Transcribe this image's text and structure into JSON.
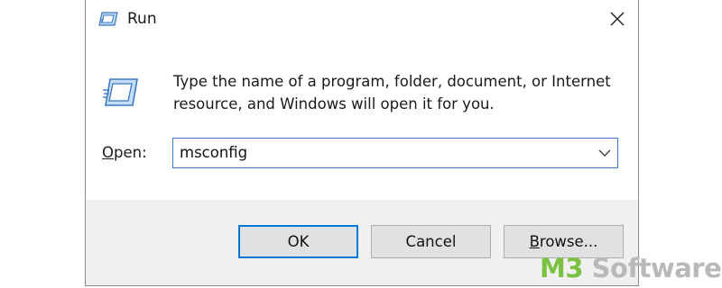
{
  "window": {
    "title": "Run",
    "close_icon": "close-icon",
    "title_icon": "run-app-icon"
  },
  "body": {
    "icon": "run-large-icon",
    "description": "Type the name of a program, folder, document, or Internet resource, and Windows will open it for you.",
    "open_label_accel": "O",
    "open_label_rest": "pen:",
    "input_value": "msconfig",
    "dropdown_icon": "chevron-down-icon"
  },
  "buttons": {
    "ok": "OK",
    "cancel": "Cancel",
    "browse_accel": "B",
    "browse_rest": "rowse..."
  },
  "watermark": {
    "brand_prefix": "M3",
    "brand_suffix": " Software"
  },
  "colors": {
    "accent": "#0078d7",
    "focus_border": "#3c7ad6",
    "footer_bg": "#f0f0f0",
    "watermark_green": "#7cc242"
  }
}
